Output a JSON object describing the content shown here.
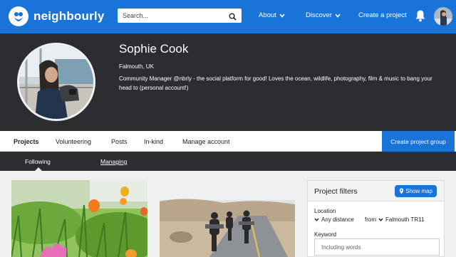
{
  "brand": {
    "name": "neighbourly",
    "color": "#1a73d9"
  },
  "search": {
    "placeholder": "Search..."
  },
  "nav": {
    "about": "About",
    "discover": "Discover",
    "create_project": "Create a project"
  },
  "profile": {
    "name": "Sophie Cook",
    "location": "Falmouth, UK",
    "bio": "Community Manager @nbrly - the social platform for good! Loves the ocean, wildlife, photography, film & music to bang your head to (personal account!)"
  },
  "tabs": [
    {
      "label": "Projects",
      "active": true
    },
    {
      "label": "Volunteering"
    },
    {
      "label": "Posts"
    },
    {
      "label": "In-kind"
    },
    {
      "label": "Manage account"
    }
  ],
  "create_group_label": "Create project group",
  "subtabs": [
    {
      "label": "Following",
      "active": true
    },
    {
      "label": "Managing"
    }
  ],
  "filters": {
    "title": "Project filters",
    "show_map": "Show map",
    "location_label": "Location",
    "distance": "Any distance",
    "from_label": "from",
    "from_value": "Falmouth TR11",
    "keyword_label": "Keyword",
    "keyword_placeholder": "Including words"
  },
  "icons": {
    "logo": "neighbourly-logo-icon",
    "search": "search-icon",
    "chevron": "chevron-down-icon",
    "bell": "bell-icon",
    "map_pin": "map-pin-icon"
  }
}
